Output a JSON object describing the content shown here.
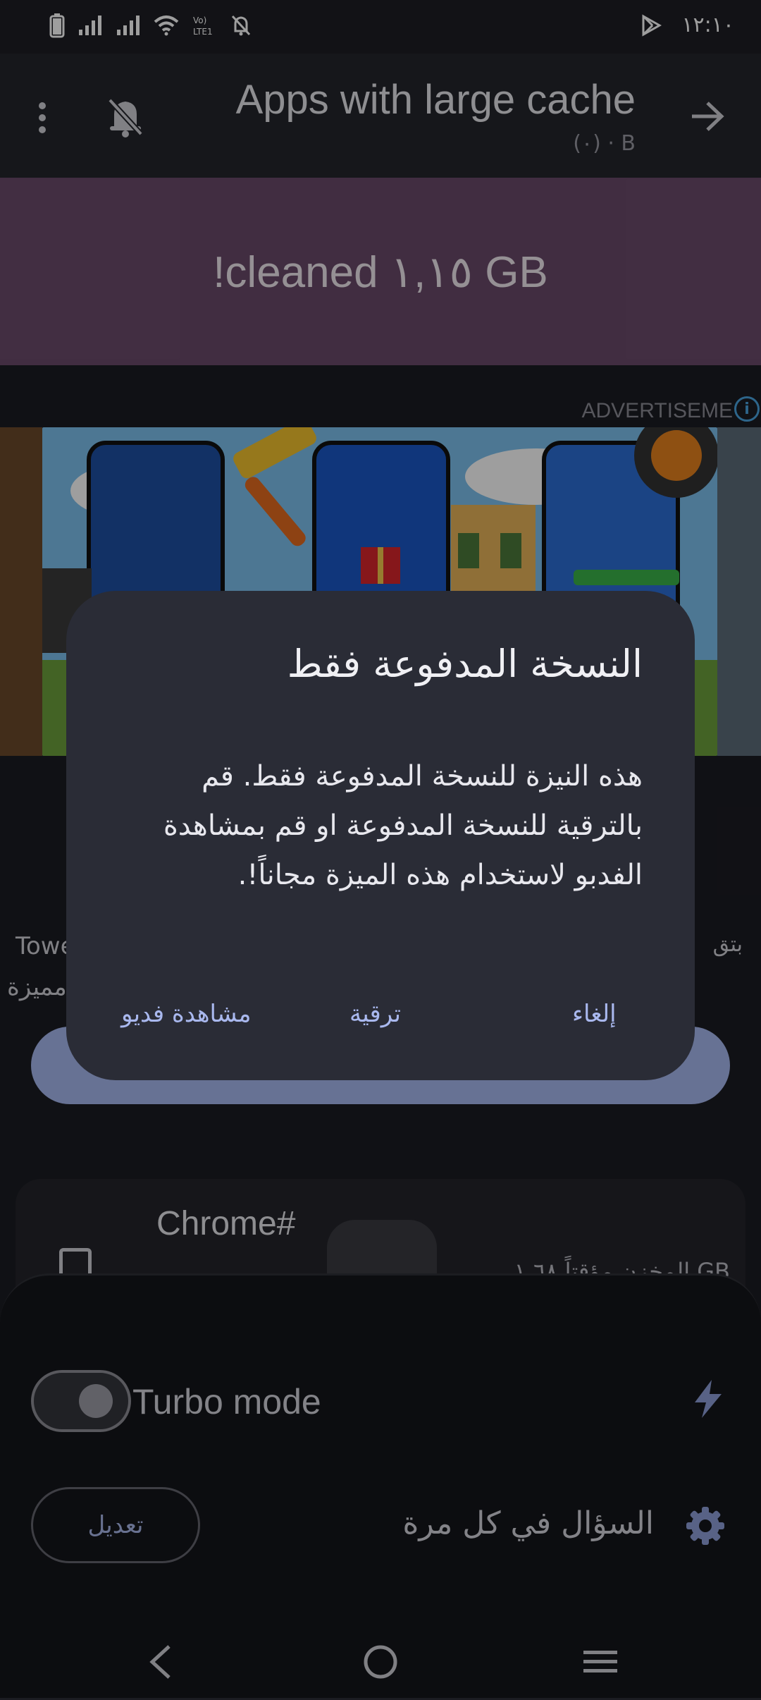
{
  "status_bar": {
    "time": "١٢:١٠",
    "icons": [
      "battery-icon",
      "signal-icon",
      "signal-icon",
      "wifi-icon",
      "volte-icon",
      "notifications-off-icon",
      "play-icon"
    ]
  },
  "app_bar": {
    "title": "Apps with large cache",
    "subtitle": "(٠) · B"
  },
  "banner": {
    "text": "!cleaned ١,١٥ GB"
  },
  "ad": {
    "label": "ADVERTISEME",
    "info": "i"
  },
  "background": {
    "left_text_1": "Towe",
    "left_text_2": "مميزة",
    "right_text": "بتق",
    "app_card": {
      "name": "Chrome#",
      "cache": "المخزن مؤقتاً ١.٦٨ GB"
    }
  },
  "dialog": {
    "title": "النسخة المدفوعة فقط",
    "body": "هذه النيزة للنسخة المدفوعة فقط. قم بالترقية للنسخة المدفوعة او قم بمشاهدة الفدبو لاستخدام هذه الميزة مجاناً!.",
    "watch_video": "مشاهدة فديو",
    "upgrade": "ترقية",
    "cancel": "إلغاء"
  },
  "sheet": {
    "turbo_label": "Turbo mode",
    "turbo_enabled": false,
    "edit_label": "تعديل",
    "ask_label": "السؤال في كل مرة"
  },
  "colors": {
    "banner": "#6a4a6a",
    "dialog": "#2a2c36",
    "accent": "#a9b8ee"
  }
}
